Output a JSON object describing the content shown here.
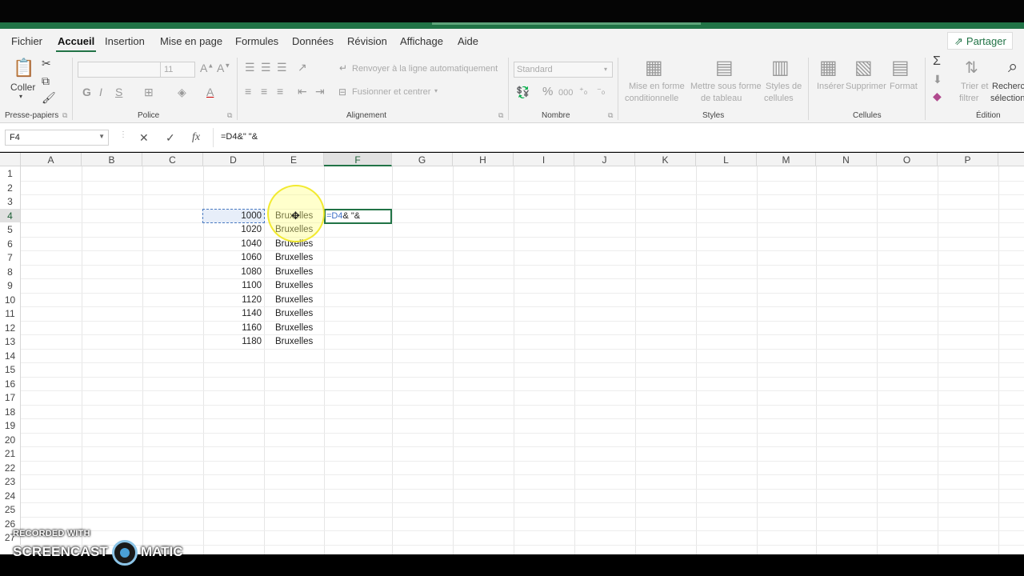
{
  "menu": {
    "tabs": [
      "Fichier",
      "Accueil",
      "Insertion",
      "Mise en page",
      "Formules",
      "Données",
      "Révision",
      "Affichage",
      "Aide"
    ],
    "active_index": 1,
    "share_label": "Partager"
  },
  "ribbon": {
    "clipboard": {
      "paste_label": "Coller",
      "group_label": "Presse-papiers"
    },
    "font": {
      "group_label": "Police",
      "size_value": "11",
      "bold": "G",
      "italic": "I",
      "underline": "S"
    },
    "alignment": {
      "group_label": "Alignement",
      "wrap_label": "Renvoyer à la ligne automatiquement",
      "merge_label": "Fusionner et centrer"
    },
    "number": {
      "group_label": "Nombre",
      "format_value": "Standard",
      "percent": "%",
      "thousands": "000"
    },
    "styles": {
      "group_label": "Styles",
      "cond_format_l1": "Mise en forme",
      "cond_format_l2": "conditionnelle",
      "table_l1": "Mettre sous forme",
      "table_l2": "de tableau",
      "cell_styles_l1": "Styles de",
      "cell_styles_l2": "cellules"
    },
    "cells": {
      "group_label": "Cellules",
      "insert_label": "Insérer",
      "delete_label": "Supprimer",
      "format_label": "Format"
    },
    "editing": {
      "group_label": "Édition",
      "sort_l1": "Trier et",
      "sort_l2": "filtrer",
      "find_l1": "Recherch",
      "find_l2": "sélection"
    }
  },
  "formula_bar": {
    "name_box": "F4",
    "formula": "=D4&\" \"&"
  },
  "sheet": {
    "columns": [
      "A",
      "B",
      "C",
      "D",
      "E",
      "F",
      "G",
      "H",
      "I",
      "J",
      "K",
      "L",
      "M",
      "N",
      "O",
      "P"
    ],
    "selected_column": "F",
    "rows": [
      "1",
      "2",
      "3",
      "4",
      "5",
      "6",
      "7",
      "8",
      "9",
      "10",
      "11",
      "12",
      "13",
      "14",
      "15",
      "16",
      "17",
      "18",
      "19",
      "20",
      "21",
      "22",
      "23",
      "24",
      "25",
      "26",
      "27"
    ],
    "data": [
      {
        "row": "4",
        "d": "1000",
        "e": "Bruxelles"
      },
      {
        "row": "5",
        "d": "1020",
        "e": "Bruxelles"
      },
      {
        "row": "6",
        "d": "1040",
        "e": "Bruxelles"
      },
      {
        "row": "7",
        "d": "1060",
        "e": "Bruxelles"
      },
      {
        "row": "8",
        "d": "1080",
        "e": "Bruxelles"
      },
      {
        "row": "9",
        "d": "1100",
        "e": "Bruxelles"
      },
      {
        "row": "10",
        "d": "1120",
        "e": "Bruxelles"
      },
      {
        "row": "11",
        "d": "1140",
        "e": "Bruxelles"
      },
      {
        "row": "12",
        "d": "1160",
        "e": "Bruxelles"
      },
      {
        "row": "13",
        "d": "1180",
        "e": "Bruxelles"
      }
    ],
    "editing_cell": {
      "ref_part": "=D4",
      "rest_part": "& \"&"
    }
  },
  "watermark": {
    "line1": "RECORDED WITH",
    "line2a": "SCREENCAST",
    "line2b": "MATIC"
  },
  "colors": {
    "accent": "#217346",
    "ref_blue": "#3e6fc6",
    "highlight": "#f0e614"
  }
}
